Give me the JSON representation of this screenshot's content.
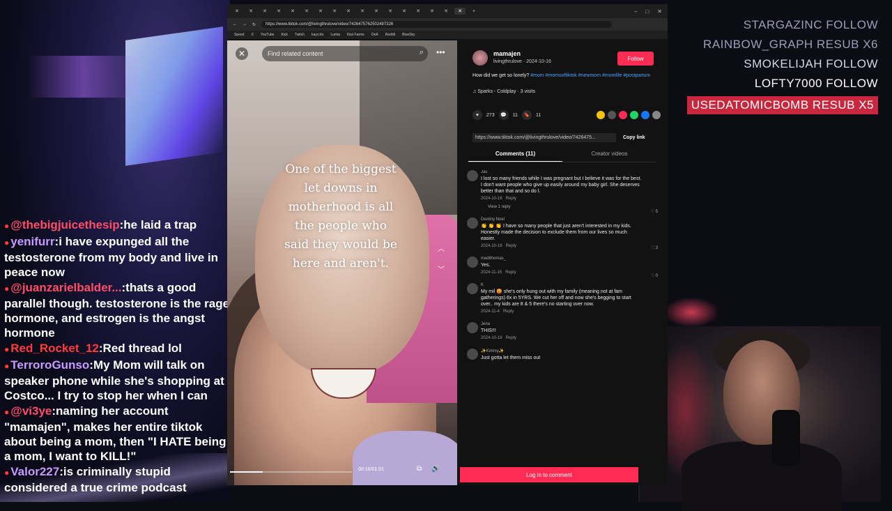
{
  "chat": [
    {
      "user": "@thebigjuicethesip",
      "text": "he laid a trap",
      "color": "#ff4d6a"
    },
    {
      "user": "yenifurr",
      "text": "i have expunged all the testosterone from my body and live in peace now",
      "color": "#c89bff"
    },
    {
      "user": "@juanzarielbalder...",
      "text": "thats a good parallel though. testosterone is the rage hormone, and estrogen is the angst hormone",
      "color": "#ff4d6a"
    },
    {
      "user": "Red_Rocket_12",
      "text": "Red thread lol",
      "color": "#ff3b3b"
    },
    {
      "user": "TerroroGunso",
      "text": "My Mom will talk on speaker phone while she's shopping at Costco... I try to stop her when I can",
      "color": "#c89bff"
    },
    {
      "user": "@vi3ye",
      "text": "naming her account \"mamajen\", makes her entire tiktok about being a mom, then \"I HATE being a mom, I want to KILL!\"",
      "color": "#ff4d6a"
    },
    {
      "user": "Valor227",
      "text": "is criminally stupid considered a true crime podcast",
      "color": "#c89bff"
    }
  ],
  "alerts": [
    {
      "text": "STARGAZINC  FOLLOW",
      "style": "dim"
    },
    {
      "text": "RAINBOW_GRAPH  RESUB X6",
      "style": "dim"
    },
    {
      "text": "SMOKELIJAH  FOLLOW",
      "style": "mid"
    },
    {
      "text": "LOFTY7000  FOLLOW",
      "style": "bright"
    },
    {
      "text": "USEDATOMICBOMB  RESUB X5",
      "style": "hl"
    }
  ],
  "browser": {
    "url": "https://www.tiktok.com/@livingthrulove/video/7426475762502487326",
    "bookmarks": [
      "Speed",
      "X",
      "YouTube",
      "Kick",
      "Twitch",
      "kayo.tts",
      "Lumia",
      "Kiwi Farms",
      "OnA",
      "Reddit",
      "BlueSky"
    ]
  },
  "video": {
    "search_placeholder": "Find related content",
    "overlay_text": "One of the biggest let downs in motherhood is all the people who said they would be here and aren't.",
    "time": "00:16/01:01",
    "progress": 0.27
  },
  "post": {
    "author": "mamajen",
    "handle_date": "livingthrulove · 2024-10-16",
    "follow_label": "Follow",
    "description": "How did we get so lonely?",
    "hashtags": "#mom #momsoftiktok #newmom #momlife #postpartum",
    "music": "♫ Sparks - Coldplay · 3 visits",
    "likes": "273",
    "comments_count": "11",
    "saves": "11",
    "link": "https://www.tiktok.com/@livingthrulove/video/7426475...",
    "copy_label": "Copy link",
    "tab_comments": "Comments (11)",
    "tab_creator": "Creator videos",
    "login_label": "Log in to comment"
  },
  "comments": [
    {
      "name": "Jas",
      "text": "I lost so many friends while I was pregnant but I believe it was for the best. I don't want people who give up easily around my baby girl. She deserves better than that and so do I.",
      "date": "2024-10-16",
      "reply": "Reply",
      "likes": "5",
      "view_replies": "View 1 reply"
    },
    {
      "name": "Destiny Noel",
      "text": "👏 👏 👏 I have so many people that just aren't interested in my kids. Honestly made the decision to exclude them from our lives so much easier.",
      "date": "2024-10-16",
      "reply": "Reply",
      "likes": "3"
    },
    {
      "name": "madithomas_",
      "text": "Yes.",
      "date": "2024-11-15",
      "reply": "Reply",
      "likes": "0"
    },
    {
      "name": "K",
      "text": "My mil 😡 she's only hung out with my family (meaning not at fam gatherings) 6x in 5YRS. We cut her off and now she's begging to start over.. my kids are 8 & 5 there's no starting over now.",
      "date": "2024-11-4",
      "reply": "Reply",
      "likes": ""
    },
    {
      "name": "Jena",
      "text": "THIS!!!",
      "date": "2024-10-16",
      "reply": "Reply",
      "likes": ""
    },
    {
      "name": "✨Kimmy✨",
      "text": "Just gotta let them miss out",
      "date": "",
      "reply": "",
      "likes": ""
    }
  ]
}
